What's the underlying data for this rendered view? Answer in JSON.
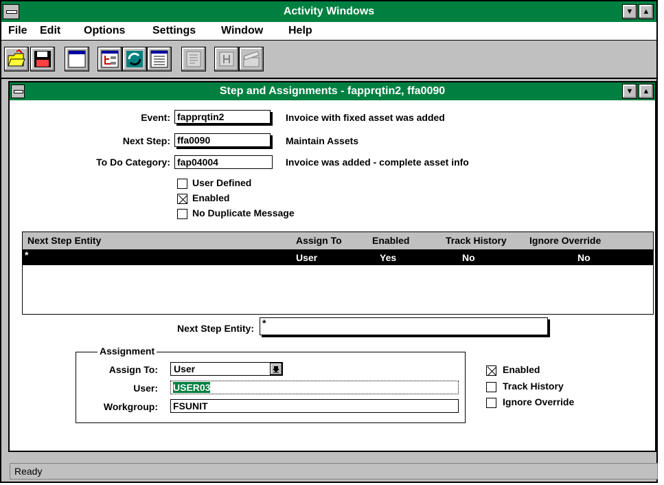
{
  "app": {
    "title": "Activity Windows"
  },
  "menu": [
    "File",
    "Edit",
    "Options",
    "Settings",
    "Window",
    "Help"
  ],
  "toolbar": {
    "icons": [
      "open-folder-icon",
      "save-disk-icon",
      "blank-window-icon",
      "tree-view-icon",
      "refresh-arrows-icon",
      "list-view-icon",
      "document-disabled-icon",
      "building-disabled-icon",
      "clapper-disabled-icon"
    ]
  },
  "child": {
    "title": "Step and Assignments - fapprqtin2, ffa0090",
    "event_label": "Event:",
    "event_value": "fapprqtin2",
    "event_desc": "Invoice with fixed asset was added",
    "next_step_label": "Next Step:",
    "next_step_value": "ffa0090",
    "next_step_desc": "Maintain Assets",
    "todo_label": "To Do Category:",
    "todo_value": "fap04004",
    "todo_desc": "Invoice was added - complete asset info",
    "chk_user_defined": "User Defined",
    "chk_enabled": "Enabled",
    "chk_no_dup": "No Duplicate Message",
    "grid": {
      "headers": [
        "Next Step Entity",
        "Assign To",
        "Enabled",
        "Track History",
        "Ignore Override"
      ],
      "rows": [
        {
          "entity": "*",
          "assign_to": "User",
          "enabled": "Yes",
          "track_history": "No",
          "ignore_override": "No"
        }
      ]
    },
    "next_step_entity_label": "Next Step Entity:",
    "next_step_entity_value": "*",
    "assignment": {
      "legend": "Assignment",
      "assign_to_label": "Assign To:",
      "assign_to_value": "User",
      "user_label": "User:",
      "user_value": "USER03",
      "workgroup_label": "Workgroup:",
      "workgroup_value": "FSUNIT"
    },
    "right_checks": {
      "enabled": "Enabled",
      "track_history": "Track History",
      "ignore_override": "Ignore Override"
    }
  },
  "status": {
    "text": "Ready"
  },
  "colors": {
    "title_green": "#008040",
    "highlight_green": "#008040"
  }
}
